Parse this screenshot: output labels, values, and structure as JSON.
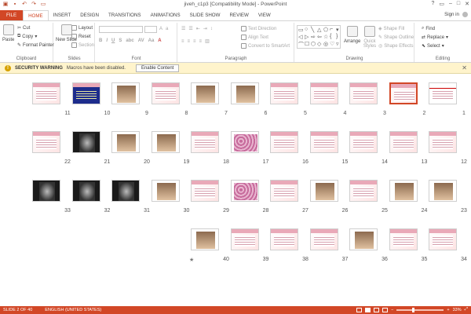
{
  "app": {
    "title": "jiveh_c1p3 [Compatibility Mode] - PowerPoint",
    "sign_in": "Sign in"
  },
  "tabs": [
    {
      "label": "FILE",
      "kind": "file"
    },
    {
      "label": "HOME",
      "kind": "active"
    },
    {
      "label": "INSERT"
    },
    {
      "label": "DESIGN"
    },
    {
      "label": "TRANSITIONS"
    },
    {
      "label": "ANIMATIONS"
    },
    {
      "label": "SLIDE SHOW"
    },
    {
      "label": "REVIEW"
    },
    {
      "label": "VIEW"
    }
  ],
  "ribbon": {
    "clipboard": {
      "paste": "Paste",
      "cut": "Cut",
      "copy": "Copy",
      "format_painter": "Format Painter",
      "label": "Clipboard"
    },
    "slides": {
      "new_slide": "New Slide",
      "layout": "Layout",
      "reset": "Reset",
      "section": "Section",
      "label": "Slides"
    },
    "font": {
      "label": "Font"
    },
    "paragraph": {
      "text_direction": "Text Direction",
      "align_text": "Align Text",
      "convert_smartart": "Convert to SmartArt",
      "label": "Paragraph"
    },
    "drawing": {
      "arrange": "Arrange",
      "quick_styles": "Quick Styles",
      "shape_fill": "Shape Fill",
      "shape_outline": "Shape Outline",
      "shape_effects": "Shape Effects",
      "label": "Drawing"
    },
    "editing": {
      "find": "Find",
      "replace": "Replace",
      "select": "Select",
      "label": "Editing"
    }
  },
  "security": {
    "title": "SECURITY WARNING",
    "message": "Macros have been disabled.",
    "button": "Enable Content"
  },
  "slides": [
    {
      "n": "1",
      "style": "redtitle",
      "selected": false
    },
    {
      "n": "2",
      "style": "pink",
      "selected": true
    },
    {
      "n": "3",
      "style": "pink"
    },
    {
      "n": "4",
      "style": "pink"
    },
    {
      "n": "5",
      "style": "pink"
    },
    {
      "n": "6",
      "style": "photo"
    },
    {
      "n": "7",
      "style": "photo"
    },
    {
      "n": "8",
      "style": "pink"
    },
    {
      "n": "9",
      "style": "photo"
    },
    {
      "n": "10",
      "style": "navy"
    },
    {
      "n": "11",
      "style": "pink"
    },
    {
      "n": "12",
      "style": "pink"
    },
    {
      "n": "13",
      "style": "pink"
    },
    {
      "n": "14",
      "style": "pink"
    },
    {
      "n": "15",
      "style": "pink"
    },
    {
      "n": "16",
      "style": "pink"
    },
    {
      "n": "17",
      "style": "micro"
    },
    {
      "n": "18",
      "style": "pink"
    },
    {
      "n": "19",
      "style": "photo"
    },
    {
      "n": "20",
      "style": "photo"
    },
    {
      "n": "21",
      "style": "dark"
    },
    {
      "n": "22",
      "style": "pink"
    },
    {
      "n": "23",
      "style": "photo"
    },
    {
      "n": "24",
      "style": "photo"
    },
    {
      "n": "25",
      "style": "pink"
    },
    {
      "n": "26",
      "style": "photo"
    },
    {
      "n": "27",
      "style": "pink"
    },
    {
      "n": "28",
      "style": "micro"
    },
    {
      "n": "29",
      "style": "pink"
    },
    {
      "n": "30",
      "style": "photo"
    },
    {
      "n": "31",
      "style": "dark"
    },
    {
      "n": "32",
      "style": "dark"
    },
    {
      "n": "33",
      "style": "dark"
    },
    {
      "n": "34",
      "style": "pink"
    },
    {
      "n": "35",
      "style": "pink"
    },
    {
      "n": "36",
      "style": "photo"
    },
    {
      "n": "37",
      "style": "pink"
    },
    {
      "n": "38",
      "style": "pink"
    },
    {
      "n": "39",
      "style": "pink"
    },
    {
      "n": "40",
      "style": "photo",
      "has_star": true
    }
  ],
  "status": {
    "slide_of": "SLIDE 2 OF 40",
    "language": "ENGLISH (UNITED STATES)",
    "zoom": "33%"
  },
  "colors": {
    "accent": "#d24726",
    "warning_bar": "#fff4cc"
  }
}
